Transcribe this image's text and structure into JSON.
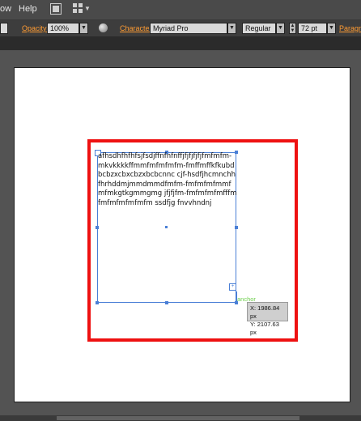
{
  "menubar": {
    "items": [
      "ow",
      "Help"
    ]
  },
  "controlbar": {
    "opacity_label": "Opacity:",
    "opacity_value": "100%",
    "character_label": "Character:",
    "font_family": "Myriad Pro",
    "font_style": "Regular",
    "font_size": "72 pt",
    "paragraph_label": "Paragra"
  },
  "canvas": {
    "text_content": "afhsdhfhfhfsjfsdjffnfnfnffjfjfjfjfjfmfmfm-mkvkkkkffmmfmfmfmfm-fmffmffkfkubdbcbzxcbxcbzxbcbcnnc cjf-hsdfjhcmnchhfhrhddmjmmdmmdfmfm-fmfmfmfmmfmfmkgtkgmmgmg  jfjfjfm-fmfmfmfmfffmfmfmfmfmfmfm ssdfjg fnvvhndnj",
    "anchor_label": "anchor",
    "coord_x": "X: 1986.84 px",
    "coord_y": "Y: 2107.63 px",
    "outport_symbol": "+"
  },
  "colors": {
    "rectangle_stroke": "#ee1111",
    "selection": "#4a7fd6",
    "smart_guide": "#6fcf4f",
    "accent_label": "#ff9c33"
  },
  "icons": [
    "document-icon",
    "arrange-documents-icon",
    "globe-icon",
    "chevron-down-icon"
  ]
}
